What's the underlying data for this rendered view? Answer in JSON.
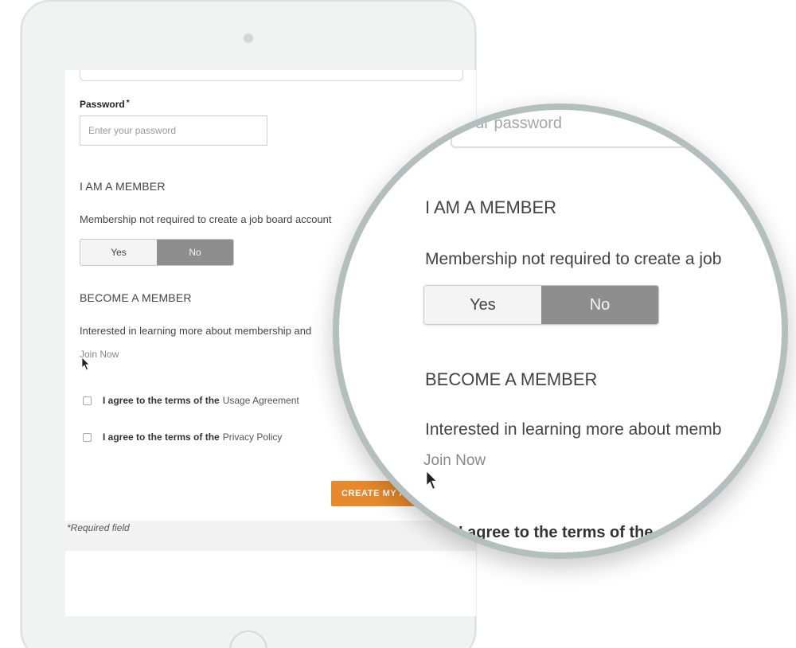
{
  "form": {
    "password_label": "Password",
    "required_marker": "*",
    "password_placeholder": "Enter your password",
    "member_section_title": "I AM A MEMBER",
    "member_note": "Membership not required to create a job board account",
    "toggle": {
      "yes_label": "Yes",
      "no_label": "No",
      "selected": "No"
    },
    "become_section_title": "BECOME A MEMBER",
    "become_text": "Interested in learning more about membership and",
    "join_link": "Join Now",
    "agreements": [
      {
        "prefix": "I agree to the terms of the",
        "link": "Usage Agreement",
        "checked": false
      },
      {
        "prefix": "I agree to the terms of the",
        "link": "Privacy Policy",
        "checked": false
      }
    ],
    "submit_label": "CREATE MY ACCOUNT",
    "required_note": "*Required field"
  },
  "magnifier": {
    "top_field_text": "your password",
    "member_section_title": "I AM A MEMBER",
    "member_note": "Membership not required to create a job",
    "yes_label": "Yes",
    "no_label": "No",
    "become_section_title": "BECOME A MEMBER",
    "become_text": "Interested in learning more about memb",
    "join_link": "Join Now",
    "agree_text": "I agree to the terms of the"
  },
  "colors": {
    "accent": "#e8892d",
    "toggle_selected": "#8e8e8e",
    "magnifier_ring": "#b3bfbf"
  },
  "icons": {
    "cursor": "arrow-cursor-icon"
  }
}
